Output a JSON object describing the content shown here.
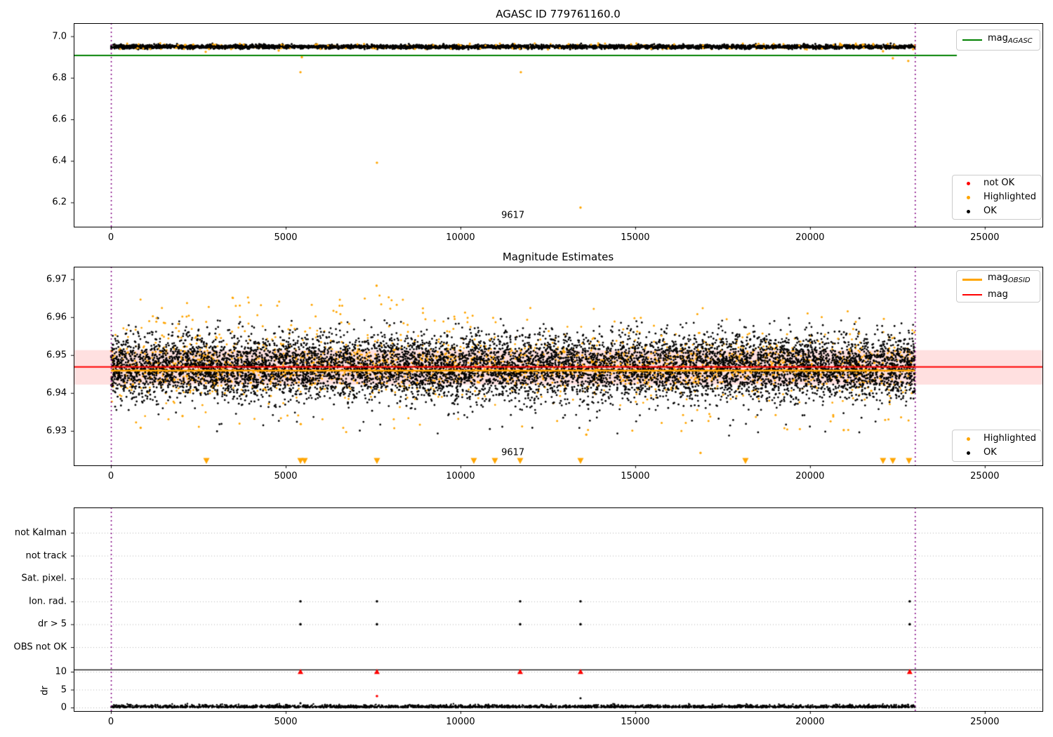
{
  "colors": {
    "ok": "#000000",
    "highlighted": "#ffa500",
    "not_ok": "#ff0000",
    "mag_agasc_line": "#008000",
    "mag_line": "#ff0000",
    "obsid_line": "#ffa500",
    "window_line": "#800080",
    "band_fill": "rgba(255,0,0,0.12)",
    "grid": "#b5b5b5",
    "separator": "#000000"
  },
  "seed": 1337,
  "x_axis": {
    "lim": [
      -1065,
      26650
    ],
    "tick_values": [
      0,
      5000,
      10000,
      15000,
      20000,
      25000
    ],
    "tick_labels": [
      "0",
      "5000",
      "10000",
      "15000",
      "20000",
      "25000"
    ]
  },
  "window": {
    "start": 0,
    "end": 23000
  },
  "chart_data": [
    {
      "type": "scatter",
      "title": "AGASC ID 779761160.0",
      "ylim": [
        6.083,
        7.063
      ],
      "ytick_values": [
        7.0,
        6.8,
        6.6,
        6.4,
        6.2
      ],
      "ytick_labels": [
        "7.0",
        "6.8",
        "6.6",
        "6.4",
        "6.2"
      ],
      "mag_agasc": 6.906,
      "agasc_line_span": [
        -1065,
        24200
      ],
      "annotation": {
        "text": "9617",
        "x": 11500,
        "y": 6.138
      },
      "legend_line": {
        "main": "mag",
        "sub": "AGASC",
        "color_key": "mag_agasc_line"
      },
      "legend_markers": [
        {
          "label": "not OK",
          "color_key": "not_ok"
        },
        {
          "label": "Highlighted",
          "color_key": "highlighted"
        },
        {
          "label": "OK",
          "color_key": "ok"
        }
      ],
      "ok_cluster": {
        "count": 3500,
        "x_range": [
          0,
          23000
        ],
        "mean": 6.9495,
        "sigma": 0.0048,
        "clip": [
          6.937,
          6.966
        ]
      },
      "highlight_under": {
        "count": 600,
        "x_range": [
          0,
          23000
        ],
        "mean": 6.9495,
        "sigma": 0.004
      },
      "highlight_clusters": [
        {
          "count": 55,
          "x_range": [
            0,
            23000
          ],
          "v_range": [
            6.956,
            6.9665
          ]
        },
        {
          "count": 28,
          "x_range": [
            0,
            23000
          ],
          "v_range": [
            6.9355,
            6.944
          ]
        }
      ],
      "highlight_outliers": [
        [
          2711,
          6.925
        ],
        [
          4799,
          6.931
        ],
        [
          5462,
          6.899
        ],
        [
          5422,
          6.827
        ],
        [
          11727,
          6.827
        ],
        [
          7610,
          6.391
        ],
        [
          13434,
          6.175
        ],
        [
          22088,
          6.928
        ],
        [
          22369,
          6.894
        ],
        [
          22811,
          6.881
        ],
        [
          22950,
          6.938
        ]
      ]
    },
    {
      "type": "scatter",
      "title": "Magnitude Estimates",
      "ylim": [
        6.9209,
        6.9733
      ],
      "ytick_values": [
        6.97,
        6.96,
        6.95,
        6.94,
        6.93
      ],
      "ytick_labels": [
        "6.97",
        "6.96",
        "6.95",
        "6.94",
        "6.93"
      ],
      "mag": 6.9468,
      "mag_err_band": [
        6.9422,
        6.9513
      ],
      "obsid_mag": 6.9462,
      "annotation": {
        "text": "9617",
        "x": 11500,
        "y": 6.9242
      },
      "legend_lines": [
        {
          "main": "mag",
          "sub": "OBSID",
          "color_key": "obsid_line",
          "lw": 3
        },
        {
          "main": "mag",
          "sub": "",
          "color_key": "mag_line",
          "lw": 2
        }
      ],
      "legend_markers": [
        {
          "label": "Highlighted",
          "color_key": "highlighted"
        },
        {
          "label": "OK",
          "color_key": "ok"
        }
      ],
      "ok_cluster": {
        "count": 9000,
        "x_range": [
          0,
          23000
        ],
        "mean": 6.9468,
        "sigma": 0.00435,
        "clip": [
          6.933,
          6.9602
        ]
      },
      "ok_low": {
        "count": 28,
        "x_range": [
          500,
          23000
        ],
        "v_range": [
          6.9285,
          6.9332
        ]
      },
      "highlight_under": {
        "count": 2200,
        "x_range": [
          0,
          23000
        ],
        "mean": 6.9468,
        "sigma": 0.0036
      },
      "highlight_clusters": [
        {
          "count": 70,
          "x_range": [
            0,
            8500
          ],
          "v_range": [
            6.9545,
            6.9658
          ]
        },
        {
          "count": 45,
          "x_range": [
            8500,
            23000
          ],
          "v_range": [
            6.954,
            6.9625
          ]
        },
        {
          "count": 40,
          "x_range": [
            0,
            23000
          ],
          "v_range": [
            6.9295,
            6.9345
          ]
        }
      ],
      "highlight_outliers": [
        [
          7600,
          6.9683
        ],
        [
          16867,
          6.9242
        ],
        [
          20964,
          6.9302
        ],
        [
          850,
          6.9308
        ],
        [
          13600,
          6.929
        ],
        [
          2048,
          6.9339
        ],
        [
          5430,
          6.9318
        ]
      ],
      "clip_triangles_x": [
        2731,
        5422,
        5542,
        7610,
        10382,
        10984,
        11707,
        13434,
        18153,
        22088,
        22369,
        22831
      ]
    },
    {
      "type": "scatter-categorical",
      "flag_rows": [
        "not Kalman",
        "not track",
        "Sat. pixel.",
        "Ion. rad.",
        "dr > 5",
        "OBS not OK"
      ],
      "dr_tick_values": [
        10,
        5,
        0
      ],
      "dr_tick_labels": [
        "10",
        "5",
        "0"
      ],
      "dr_axis_label": "dr",
      "separator_dr": 10.6,
      "flag_points": [
        {
          "x": 5422,
          "rows": [
            3,
            4
          ]
        },
        {
          "x": 7610,
          "rows": [
            3,
            4
          ]
        },
        {
          "x": 11707,
          "rows": [
            3,
            4
          ]
        },
        {
          "x": 13434,
          "rows": [
            3,
            4
          ]
        },
        {
          "x": 22852,
          "rows": [
            3,
            4
          ]
        }
      ],
      "dr_clipped_red_x": [
        5422,
        7610,
        11707,
        13434,
        22852
      ],
      "dr_red_points": [
        [
          7610,
          3.2
        ]
      ],
      "dr_black_points": [
        [
          5422,
          1.2
        ],
        [
          13434,
          2.6
        ]
      ],
      "dr_cluster": {
        "count": 2800,
        "x_range": [
          0,
          23000
        ],
        "v_max": 1.0
      }
    }
  ]
}
